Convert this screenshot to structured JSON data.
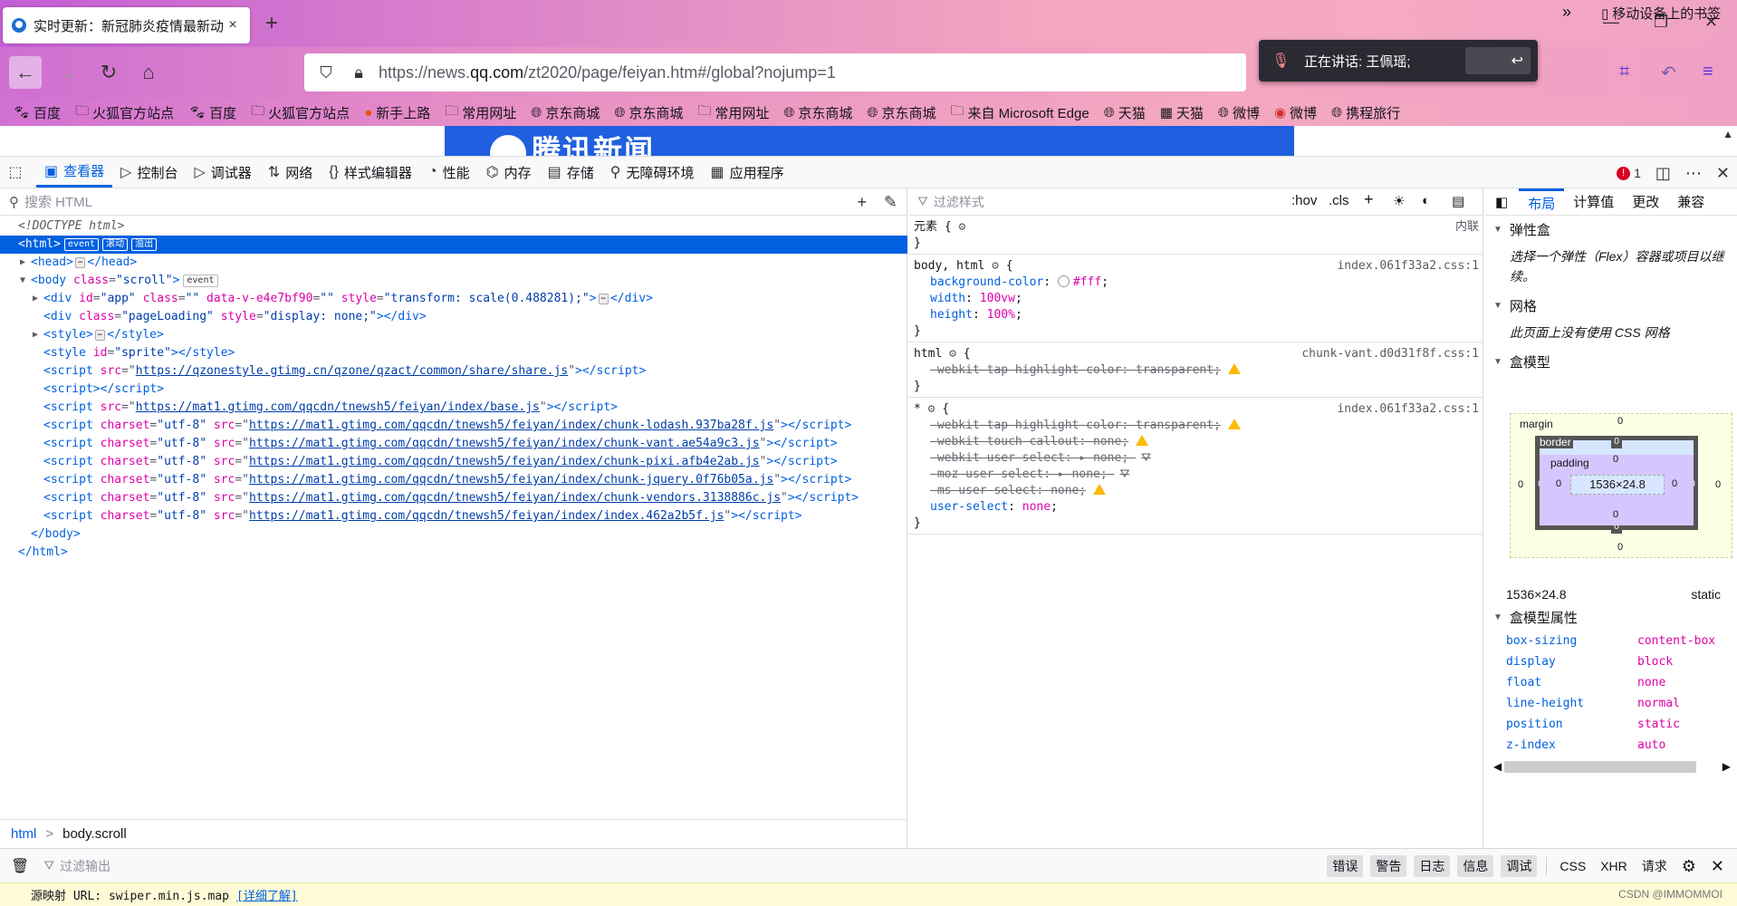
{
  "browser": {
    "tab": {
      "title": "实时更新：新冠肺炎疫情最新动",
      "close": "×"
    },
    "new_tab": "+",
    "window_controls": {
      "minimize": "—",
      "restore": "❐",
      "close": "✕"
    },
    "url": {
      "prefix": "https://news.",
      "domain": "qq.com",
      "suffix": "/zt2020/page/feiyan.htm#/global?nojump=1"
    },
    "notification": {
      "text": "正在讲话: 王佩瑶;"
    },
    "bookmarks": [
      {
        "label": "百度",
        "icon": "paw-icon"
      },
      {
        "label": "火狐官方站点",
        "icon": "folder-icon"
      },
      {
        "label": "百度",
        "icon": "paw-icon"
      },
      {
        "label": "火狐官方站点",
        "icon": "folder-icon"
      },
      {
        "label": "新手上路",
        "icon": "firefox-icon"
      },
      {
        "label": "常用网址",
        "icon": "folder-icon"
      },
      {
        "label": "京东商城",
        "icon": "globe-icon"
      },
      {
        "label": "京东商城",
        "icon": "globe-icon"
      },
      {
        "label": "常用网址",
        "icon": "folder-icon"
      },
      {
        "label": "京东商城",
        "icon": "globe-icon"
      },
      {
        "label": "京东商城",
        "icon": "globe-icon"
      },
      {
        "label": "来自 Microsoft Edge",
        "icon": "folder-icon"
      },
      {
        "label": "天猫",
        "icon": "globe-icon"
      },
      {
        "label": "天猫",
        "icon": "image-icon"
      },
      {
        "label": "微博",
        "icon": "globe-icon"
      },
      {
        "label": "微博",
        "icon": "weibo-icon"
      },
      {
        "label": "携程旅行",
        "icon": "globe-icon"
      }
    ],
    "bookmarks_more": "»",
    "mobile_bookmarks": "移动设备上的书签",
    "page_banner": "腾讯新闻"
  },
  "devtools": {
    "tabs": [
      "查看器",
      "控制台",
      "调试器",
      "网络",
      "样式编辑器",
      "性能",
      "内存",
      "存储",
      "无障碍环境",
      "应用程序"
    ],
    "active_tab": "查看器",
    "error_count": "1",
    "inspector": {
      "search_placeholder": "搜索 HTML",
      "doctype": "<!DOCTYPE html>",
      "html_open": "<html>",
      "html_badges": [
        "event",
        "滚动",
        "溢出"
      ],
      "head": {
        "open": "<head>",
        "close": "</head>"
      },
      "body": {
        "tag": "body",
        "class_name": "class",
        "class_val": "\"scroll\"",
        "badge": "event"
      },
      "app_div": {
        "id_val": "\"app\"",
        "class_val": "\"\"",
        "datav": "data-v-e4e7bf90",
        "datav_val": "\"\"",
        "style_val": "\"transform: scale(0.488281);\""
      },
      "loading_div": {
        "class_val": "\"pageLoading\"",
        "style_val": "\"display: none;\""
      },
      "scripts": [
        {
          "src": "https://qzonestyle.gtimg.cn/qzone/qzact/common/share/share.js",
          "charset": false
        },
        {
          "src": "https://mat1.gtimg.com/qqcdn/tnewsh5/feiyan/index/base.js",
          "charset": false
        },
        {
          "src": "https://mat1.gtimg.com/qqcdn/tnewsh5/feiyan/index/chunk-lodash.937ba28f.js",
          "charset": true
        },
        {
          "src": "https://mat1.gtimg.com/qqcdn/tnewsh5/feiyan/index/chunk-vant.ae54a9c3.js",
          "charset": true
        },
        {
          "src": "https://mat1.gtimg.com/qqcdn/tnewsh5/feiyan/index/chunk-pixi.afb4e2ab.js",
          "charset": true
        },
        {
          "src": "https://mat1.gtimg.com/qqcdn/tnewsh5/feiyan/index/chunk-jquery.0f76b05a.js",
          "charset": true
        },
        {
          "src": "https://mat1.gtimg.com/qqcdn/tnewsh5/feiyan/index/chunk-vendors.3138886c.js",
          "charset": true
        },
        {
          "src": "https://mat1.gtimg.com/qqcdn/tnewsh5/feiyan/index/index.462a2b5f.js",
          "charset": true
        }
      ],
      "breadcrumbs": [
        "html",
        "body.scroll"
      ]
    },
    "rules": {
      "filter_placeholder": "过滤样式",
      "hov": ":hov",
      "cls": ".cls",
      "element_rule": {
        "selector": "元素 {",
        "close": "}",
        "source": "内联"
      },
      "rule_list": [
        {
          "selector": "body, html",
          "source": "index.061f33a2.css:1",
          "decls": [
            {
              "prop": "background-color",
              "val": "#fff",
              "struck": false,
              "swatch": true
            },
            {
              "prop": "width",
              "val": "100vw",
              "struck": false
            },
            {
              "prop": "height",
              "val": "100%",
              "struck": false
            }
          ]
        },
        {
          "selector": "html",
          "source": "chunk-vant.d0d31f8f.css:1",
          "decls": [
            {
              "prop": "-webkit-tap-highlight-color",
              "val": "transparent",
              "struck": true,
              "warn": true
            }
          ]
        },
        {
          "selector": "*",
          "source": "index.061f33a2.css:1",
          "decls": [
            {
              "prop": "-webkit-tap-highlight-color",
              "val": "transparent",
              "struck": true,
              "warn": true
            },
            {
              "prop": "-webkit-touch-callout",
              "val": "none",
              "struck": true,
              "warn": true
            },
            {
              "prop": "-webkit-user-select",
              "val": "none",
              "struck": true,
              "filter": true
            },
            {
              "prop": "-moz-user-select",
              "val": "none",
              "struck": true,
              "filter": true
            },
            {
              "prop": "-ms-user-select",
              "val": "none",
              "struck": true,
              "warn": true
            },
            {
              "prop": "user-select",
              "val": "none",
              "struck": false
            }
          ]
        }
      ]
    },
    "layout": {
      "tabs": [
        "布局",
        "计算值",
        "更改",
        "兼容"
      ],
      "flex_title": "弹性盒",
      "flex_note": "选择一个弹性（Flex）容器或项目以继续。",
      "grid_title": "网格",
      "grid_note": "此页面上没有使用 CSS 网格",
      "boxmodel_title": "盒模型",
      "margin_label": "margin",
      "border_label": "border",
      "padding_label": "padding",
      "zero": "0",
      "content_size": "1536×24.8",
      "size_readout": "1536×24.8",
      "position_readout": "static",
      "props_title": "盒模型属性",
      "props": [
        {
          "k": "box-sizing",
          "v": "content-box"
        },
        {
          "k": "display",
          "v": "block"
        },
        {
          "k": "float",
          "v": "none"
        },
        {
          "k": "line-height",
          "v": "normal"
        },
        {
          "k": "position",
          "v": "static"
        },
        {
          "k": "z-index",
          "v": "auto"
        }
      ]
    },
    "console": {
      "filter_placeholder": "过滤输出",
      "levels": [
        "错误",
        "警告",
        "日志",
        "信息",
        "调试"
      ],
      "types": [
        "CSS",
        "XHR",
        "请求"
      ],
      "message": "源映射 URL: swiper.min.js.map",
      "learn_more": "[详细了解]"
    }
  },
  "watermark": "CSDN @IMMOMMOI",
  "colors": {
    "accent": "#0060df",
    "selection": "#0060df",
    "error": "#d70022",
    "warning": "#ffb900"
  }
}
